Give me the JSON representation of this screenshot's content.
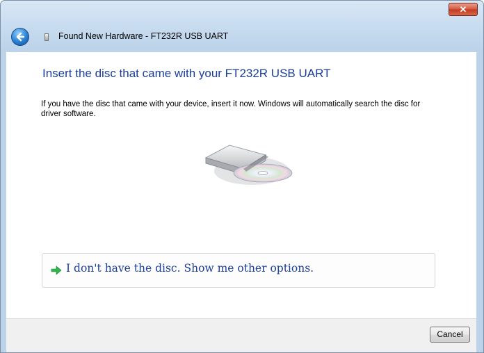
{
  "window": {
    "title": "Found New Hardware - FT232R USB UART",
    "close_label": "✕"
  },
  "main": {
    "heading": "Insert the disc that came with your FT232R USB UART",
    "instruction": "If you have the disc that came with your device, insert it now.  Windows will automatically search the disc for driver software.",
    "option_label": "I don't have the disc.  Show me other options."
  },
  "footer": {
    "cancel_label": "Cancel"
  },
  "colors": {
    "heading": "#1b3e9c",
    "option_arrow": "#2db84d",
    "close_button": "#c8412a"
  },
  "icons": {
    "back": "back-arrow-icon",
    "device": "usb-device-icon",
    "disc": "disc-drive-icon",
    "option": "green-arrow-icon"
  }
}
